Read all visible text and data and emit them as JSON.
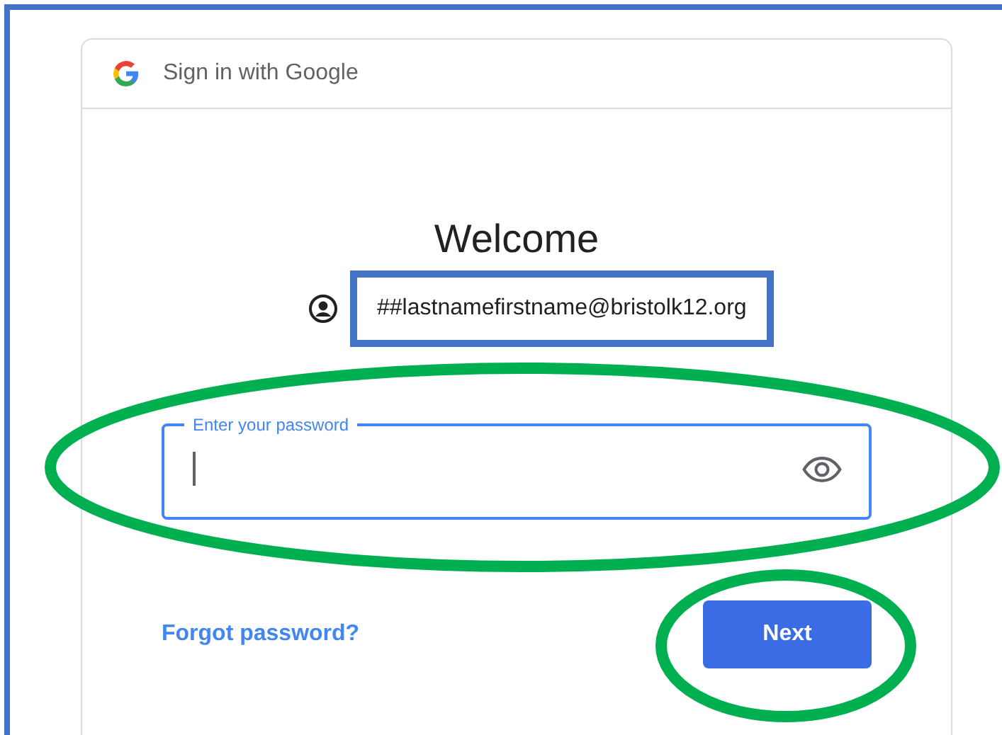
{
  "header": {
    "title": "Sign in with Google"
  },
  "welcome": "Welcome",
  "account": {
    "email": "##lastnamefirstname@bristolk12.org",
    "highlighted": true
  },
  "password": {
    "label": "Enter your password",
    "focused": true,
    "circled": true
  },
  "forgot_link": "Forgot password?",
  "next_button": {
    "label": "Next",
    "circled": true
  }
}
